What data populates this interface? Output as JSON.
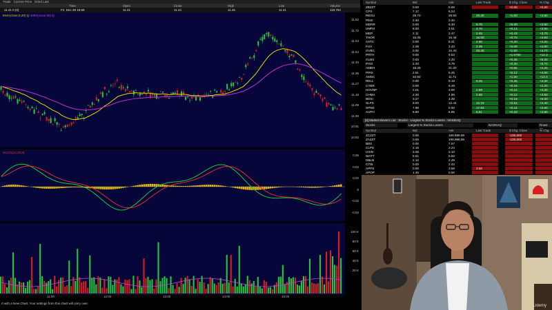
{
  "chart_window": {
    "top_tabs": [
      "Trade",
      "Current Price",
      "Dried Last"
    ],
    "quote_header": [
      "Time",
      "Open",
      "Close",
      "High",
      "Low",
      "Volume"
    ],
    "quote_row": {
      "last": "11.41  0 (0)",
      "time": "Fri, Dec 28  15:59",
      "open": "11.41",
      "close": "11.44",
      "high": "11.46",
      "low": "11.41",
      "volume": "118,794"
    },
    "price_pane": {
      "legend": [
        "EMA(close,9,20) Q",
        "EMA(close,50) Q"
      ],
      "y_ticks": [
        "11.82",
        "11.72",
        "11.63",
        "11.54",
        "11.45",
        "11.36",
        "11.27",
        "11.18",
        "11.09",
        "11.00",
        "10.91",
        "10.82"
      ]
    },
    "osc_pane": {
      "title": "MACD(12,26,9)",
      "y_ticks": [
        "0.06",
        "0.04",
        "0.02",
        "0",
        "-0.02",
        "-0.04"
      ]
    },
    "volume_pane": {
      "y_ticks": [
        "100 K",
        "80 K",
        "60 K",
        "40 K",
        "20 K"
      ]
    },
    "time_axis": [
      "11:00",
      "12:00",
      "13:00",
      "14:00",
      "15:00"
    ],
    "status": "rt with a New Chart. Your settings from this chart will carry over."
  },
  "colors": {
    "pane_bg": "#06063a",
    "up": "#22c83a",
    "down": "#d81e1e",
    "ema_fast": "#e6dc00",
    "ema_slow": "#b030c0",
    "pos_bg": "#0f6a1a",
    "neg_bg": "#8a0d0d"
  },
  "quote_board": {
    "columns": [
      "Symbol",
      "Bid",
      "Ask",
      "Last Trade",
      "$ Chg. Close",
      "% Chg"
    ],
    "rows": [
      [
        "ZBZZT",
        "0.00",
        "0.00",
        "",
        "+0.00",
        "+0.00",
        "neg"
      ],
      [
        "CPX",
        "7.17",
        "6.24",
        "",
        "",
        "",
        ""
      ],
      [
        "REGU",
        "28.70",
        "28.50",
        "29.30",
        "+1.00",
        "+3.50",
        "pos"
      ],
      [
        "PESI",
        "2.40",
        "2.40",
        "",
        "",
        "",
        ""
      ],
      [
        "MDRR",
        "0.00",
        "9.30",
        "8.70",
        "+0.30",
        "+3.50",
        "pos"
      ],
      [
        "UMRX",
        "8.00",
        "3.51",
        "3.70",
        "+0.13",
        "+3.50",
        "pos"
      ],
      [
        "MEP",
        "2.11",
        "2.47",
        "2.45",
        "+0.43",
        "+3.70",
        "pos"
      ],
      [
        "THOR",
        "15.05",
        "16.48",
        "16.00",
        "+0.70",
        "+4.50",
        "pos"
      ],
      [
        "ASTC",
        "0.00",
        "5.41",
        "4.90",
        "+0.20",
        "+4.20",
        "pos"
      ],
      [
        "FUV",
        "2.08",
        "2.43",
        "2.39",
        "+0.09",
        "+4.00",
        "pos"
      ],
      [
        "OVBC",
        "0.00",
        "34.40",
        "33.45",
        "+1.50",
        "+4.70",
        "pos"
      ],
      [
        "PRTH",
        "0.00",
        "9.53",
        "",
        "+1.0700",
        "+12.3",
        "pos"
      ],
      [
        "GLBS",
        "0.00",
        "3.20",
        "",
        "+0.38",
        "+5.20",
        "pos"
      ],
      [
        "PIXX",
        "2.20",
        "3.79",
        "",
        "+0.20",
        "+5.70",
        "pos"
      ],
      [
        "AMEH",
        "18.25",
        "21.20",
        "",
        "+0.85",
        "+4.20",
        "pos"
      ],
      [
        "PIRS",
        "2.91",
        "5.25",
        "",
        "+0.12",
        "+4.60",
        "pos"
      ],
      [
        "AMSC",
        "10.50",
        "11.71",
        "",
        "+1.20",
        "+12.4",
        "pos"
      ],
      [
        "RELL",
        "0.00",
        "9.19",
        "8.25",
        "+0.35",
        "+4.30",
        "pos"
      ],
      [
        "CYBR",
        "0.00",
        "8.49",
        "",
        "+0.19",
        "+2.20",
        "pos"
      ],
      [
        "HOVNP",
        "2.01",
        "3.00",
        "2.89",
        "+0.12",
        "+4.30",
        "pos"
      ],
      [
        "CHMA",
        "2.30",
        "4.90",
        "2.80",
        "+0.12",
        "+4.50",
        "pos"
      ],
      [
        "BDSI",
        "3.27",
        "3.39",
        "",
        "+0.18",
        "+5.00",
        "pos"
      ],
      [
        "SLPS",
        "9.00",
        "12.44",
        "12.19",
        "+0.52",
        "+4.40",
        "pos"
      ],
      [
        "SPNE",
        "7.98",
        "0.00",
        "17.93",
        "+0.44",
        "+2.50",
        "pos"
      ],
      [
        "AUPH",
        "6.80",
        "6.85",
        "6.81",
        "+0.23",
        "+3.50",
        "pos"
      ]
    ]
  },
  "movers_panel": {
    "title": "[9] Market Movers List - Stocks - Largest % Stocks Losers - NASDAQ",
    "filter_type": "Stocks",
    "filter_metric": "Largest % Stocks Losers",
    "filter_exchange": "NASDAQ",
    "filter_rows": "Rows: 25",
    "columns": [
      "Symbol",
      "Bid",
      "Ask",
      "Last Trade",
      "$ Chg. Close",
      "% Chg"
    ],
    "rows": [
      [
        "ZCZZT",
        "0.00",
        "199,999.99",
        "",
        "-100,000",
        "",
        "neg"
      ],
      [
        "ZAZZT",
        "0.00",
        "199,999.99",
        "",
        "-100,000",
        "",
        "neg"
      ],
      [
        "BBX",
        "0.00",
        "7.57",
        "",
        "",
        "",
        "neg"
      ],
      [
        "CLPS",
        "2.19",
        "2.24",
        "",
        "",
        "",
        "neg"
      ],
      [
        "UXIN",
        "3.05",
        "3.13",
        "",
        "",
        "",
        "neg"
      ],
      [
        "WATT",
        "5.81",
        "5.83",
        "",
        "",
        "",
        "neg"
      ],
      [
        "DBLN",
        "2.12",
        "2.49",
        "",
        "",
        "",
        "neg"
      ],
      [
        "CTIB",
        "0.00",
        "2.43",
        "",
        "",
        "",
        "neg"
      ],
      [
        "APPS",
        "0.00",
        "3.58",
        "3.56",
        "",
        "",
        "neg"
      ],
      [
        "APOP",
        "1.45",
        "0.00",
        "",
        "",
        "",
        "neg"
      ]
    ]
  },
  "webcam": {
    "watermark": "Udemy"
  }
}
